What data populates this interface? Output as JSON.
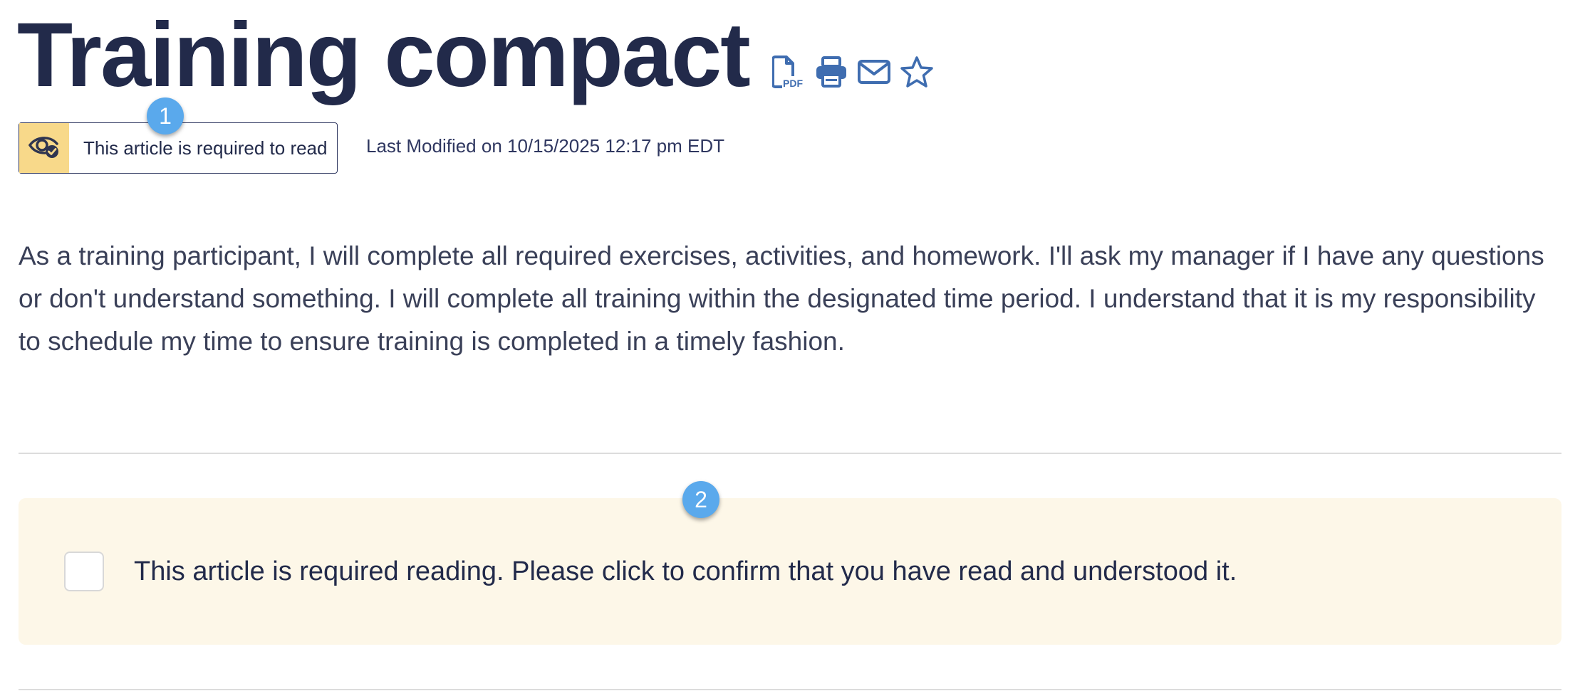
{
  "article": {
    "title": "Training compact",
    "toolbar_icons": [
      "pdf-icon",
      "print-icon",
      "email-icon",
      "star-icon"
    ],
    "pdf_icon_text": "PDF",
    "required_badge": {
      "label": "This article is required to read",
      "icon": "eye-check-icon"
    },
    "last_modified": "Last Modified on 10/15/2025 12:17 pm EDT",
    "body": "As a training participant, I will complete all required exercises, activities, and homework. I'll ask my manager if I have any questions or don't understand something. I will complete all training within the designated time period. I understand that it is my responsibility to schedule my time to ensure training is completed in a timely fashion."
  },
  "confirmation": {
    "text": "This article is required reading. Please click to confirm that you have read and understood it.",
    "checked": false
  },
  "markers": [
    "1",
    "2"
  ],
  "colors": {
    "title": "#222a4a",
    "icon": "#3f6db0",
    "badge_highlight": "#f8d98a",
    "confirm_background": "#fdf7e8",
    "marker": "#5aa9ec"
  }
}
